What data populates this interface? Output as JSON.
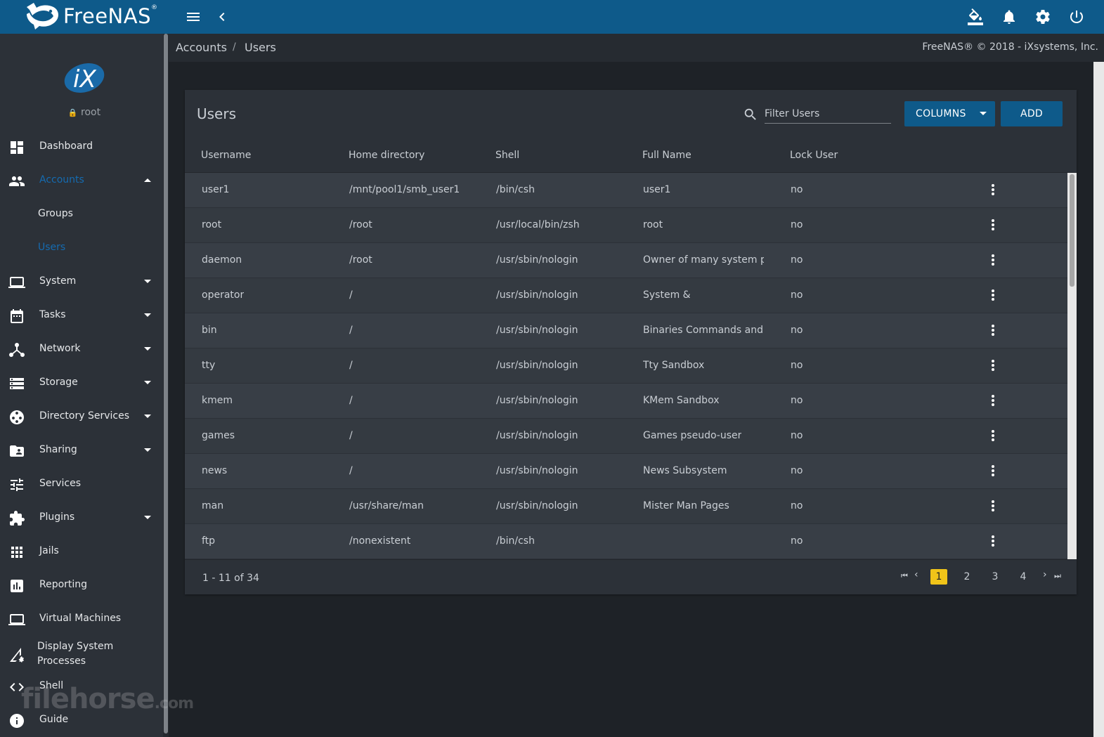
{
  "brand": {
    "name": "FreeNAS",
    "mark": "®"
  },
  "topbar": {
    "icons": [
      "menu-icon",
      "chevron-left-icon",
      "paint-bucket-icon",
      "bell-icon",
      "gear-icon",
      "power-icon"
    ]
  },
  "sidebar": {
    "logo": "iX",
    "user": "root",
    "items": [
      {
        "label": "Dashboard",
        "icon": "dashboard-icon",
        "caret": ""
      },
      {
        "label": "Accounts",
        "icon": "people-icon",
        "caret": "up",
        "active": true
      },
      {
        "label": "Groups",
        "sub": true
      },
      {
        "label": "Users",
        "sub": true,
        "active": true
      },
      {
        "label": "System",
        "icon": "laptop-icon",
        "caret": "down"
      },
      {
        "label": "Tasks",
        "icon": "calendar-icon",
        "caret": "down"
      },
      {
        "label": "Network",
        "icon": "network-icon",
        "caret": "down"
      },
      {
        "label": "Storage",
        "icon": "storage-icon",
        "caret": "down"
      },
      {
        "label": "Directory Services",
        "icon": "directory-icon",
        "caret": "down"
      },
      {
        "label": "Sharing",
        "icon": "folder-shared-icon",
        "caret": "down"
      },
      {
        "label": "Services",
        "icon": "tune-icon",
        "caret": ""
      },
      {
        "label": "Plugins",
        "icon": "puzzle-icon",
        "caret": "down"
      },
      {
        "label": "Jails",
        "icon": "grid-icon",
        "caret": ""
      },
      {
        "label": "Reporting",
        "icon": "chart-icon",
        "caret": ""
      },
      {
        "label": "Virtual Machines",
        "icon": "laptop-icon",
        "caret": ""
      },
      {
        "label": "Display System Processes",
        "icon": "processes-icon",
        "caret": ""
      },
      {
        "label": "Shell",
        "icon": "code-icon",
        "caret": ""
      },
      {
        "label": "Guide",
        "icon": "info-icon",
        "caret": ""
      }
    ],
    "display_processes_line1": "Display System",
    "display_processes_line2": "Processes",
    "watermark": "filehorse",
    "watermark_suffix": ".com"
  },
  "breadcrumb": {
    "items": [
      "Accounts",
      "Users"
    ],
    "separator": "/"
  },
  "copyright": "FreeNAS® © 2018 - iXsystems, Inc.",
  "users_card": {
    "title": "Users",
    "filter_placeholder": "Filter Users",
    "columns_button": "COLUMNS",
    "add_button": "ADD",
    "headers": [
      "Username",
      "Home directory",
      "Shell",
      "Full Name",
      "Lock User"
    ],
    "rows": [
      [
        "user1",
        "/mnt/pool1/smb_user1",
        "/bin/csh",
        "user1",
        "no"
      ],
      [
        "root",
        "/root",
        "/usr/local/bin/zsh",
        "root",
        "no"
      ],
      [
        "daemon",
        "/root",
        "/usr/sbin/nologin",
        "Owner of many system p",
        "no"
      ],
      [
        "operator",
        "/",
        "/usr/sbin/nologin",
        "System &",
        "no"
      ],
      [
        "bin",
        "/",
        "/usr/sbin/nologin",
        "Binaries Commands and",
        "no"
      ],
      [
        "tty",
        "/",
        "/usr/sbin/nologin",
        "Tty Sandbox",
        "no"
      ],
      [
        "kmem",
        "/",
        "/usr/sbin/nologin",
        "KMem Sandbox",
        "no"
      ],
      [
        "games",
        "/",
        "/usr/sbin/nologin",
        "Games pseudo-user",
        "no"
      ],
      [
        "news",
        "/",
        "/usr/sbin/nologin",
        "News Subsystem",
        "no"
      ],
      [
        "man",
        "/usr/share/man",
        "/usr/sbin/nologin",
        "Mister Man Pages",
        "no"
      ],
      [
        "ftp",
        "/nonexistent",
        "/bin/csh",
        "",
        "no"
      ]
    ],
    "range_text": "1 - 11 of 34",
    "pages": [
      "1",
      "2",
      "3",
      "4"
    ],
    "current_page": "1",
    "pager_first": "⏮",
    "pager_prev": "‹",
    "pager_next": "›",
    "pager_last": "⏭"
  },
  "colors": {
    "topbar": "#0e5a8a",
    "sidebar": "#2c3138",
    "accent": "#156bb0",
    "current_page": "#f0c419"
  }
}
